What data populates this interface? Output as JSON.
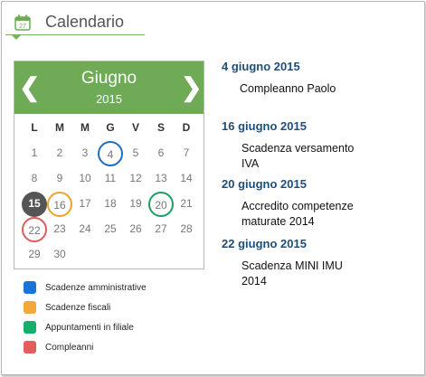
{
  "header": {
    "title": "Calendario",
    "icon_number": "27"
  },
  "calendar": {
    "month": "Giugno",
    "year": "2015",
    "weekdays": [
      "L",
      "M",
      "M",
      "G",
      "V",
      "S",
      "D"
    ],
    "days": [
      "1",
      "2",
      "3",
      "4",
      "5",
      "6",
      "7",
      "8",
      "9",
      "10",
      "11",
      "12",
      "13",
      "14",
      "15",
      "16",
      "17",
      "18",
      "19",
      "20",
      "21",
      "22",
      "23",
      "24",
      "25",
      "26",
      "27",
      "28",
      "29",
      "30"
    ],
    "highlighted": [
      {
        "day": "4",
        "type": "amministrative",
        "color": "#1a6fc0"
      },
      {
        "day": "15",
        "type": "today",
        "color": "#555555"
      },
      {
        "day": "16",
        "type": "fiscali",
        "color": "#efa32a"
      },
      {
        "day": "20",
        "type": "filiale",
        "color": "#1aa064"
      },
      {
        "day": "22",
        "type": "compleanni",
        "color": "#e05b5b"
      }
    ]
  },
  "legend": [
    {
      "label": "Scadenze amministrative",
      "color": "#1a73d9"
    },
    {
      "label": "Scadenze fiscali",
      "color": "#f2a93b"
    },
    {
      "label": "Appuntamenti in filiale",
      "color": "#12b06a"
    },
    {
      "label": "Compleanni",
      "color": "#e45c5c"
    }
  ],
  "events": [
    {
      "date": "4 giugno 2015",
      "lines": [
        "Compleanno Paolo"
      ]
    },
    {
      "date": "16 giugno 2015",
      "lines": [
        "Scadenza versamento",
        "IVA"
      ]
    },
    {
      "date": "20 giugno 2015",
      "lines": [
        "Accredito competenze",
        "maturate 2014"
      ]
    },
    {
      "date": "22 giugno 2015",
      "lines": [
        "Scadenza MINI IMU",
        "2014"
      ]
    }
  ],
  "colors": {
    "accent": "#6faa56",
    "date_text": "#1f4e79"
  }
}
